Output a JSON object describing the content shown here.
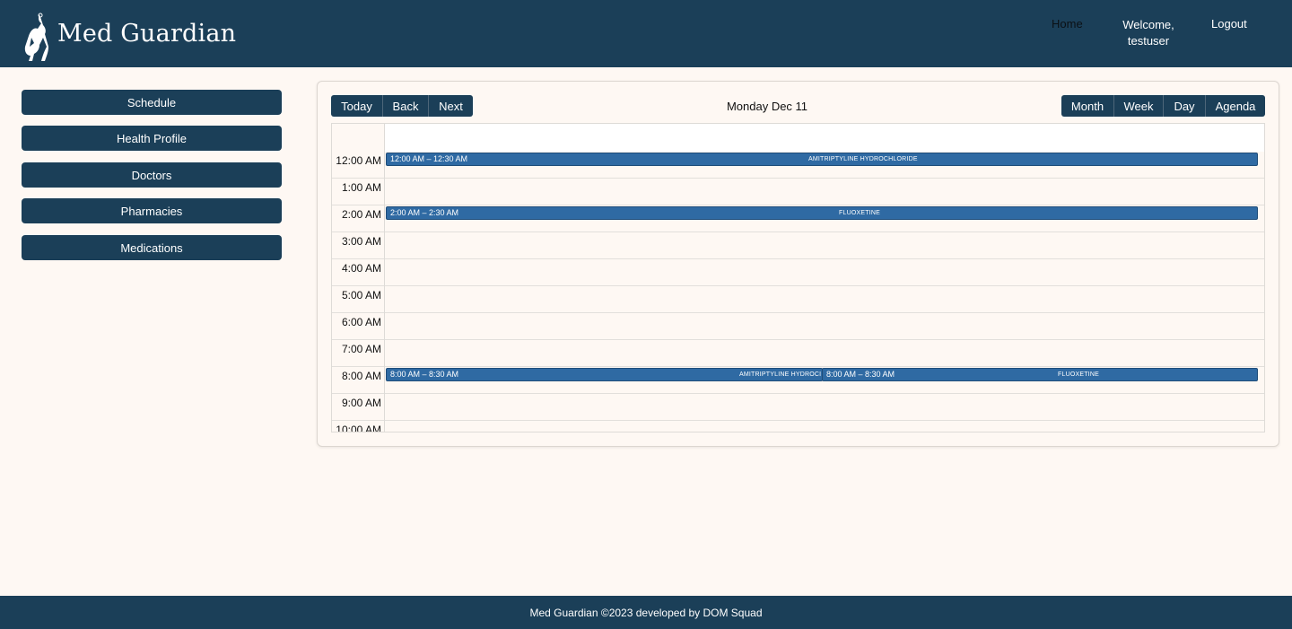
{
  "header": {
    "brand": "Med Guardian",
    "nav": {
      "home": "Home",
      "welcome": "Welcome,",
      "username": "testuser",
      "logout": "Logout"
    }
  },
  "sidebar": {
    "items": [
      {
        "label": "Schedule"
      },
      {
        "label": "Health Profile"
      },
      {
        "label": "Doctors"
      },
      {
        "label": "Pharmacies"
      },
      {
        "label": "Medications"
      }
    ]
  },
  "calendar": {
    "nav_buttons": {
      "today": "Today",
      "back": "Back",
      "next": "Next"
    },
    "title": "Monday Dec 11",
    "views": {
      "month": "Month",
      "week": "Week",
      "day": "Day",
      "agenda": "Agenda"
    },
    "hours": [
      "12:00 AM",
      "1:00 AM",
      "2:00 AM",
      "3:00 AM",
      "4:00 AM",
      "5:00 AM",
      "6:00 AM",
      "7:00 AM",
      "8:00 AM",
      "9:00 AM",
      "10:00 AM"
    ],
    "events": [
      {
        "time": "12:00 AM – 12:30 AM",
        "name": "AMITRIPTYLINE HYDROCHLORIDE"
      },
      {
        "time": "2:00 AM – 2:30 AM",
        "name": "FLUOXETINE"
      },
      {
        "time": "8:00 AM – 8:30 AM",
        "name": "AMITRIPTYLINE HYDROCI"
      },
      {
        "time": "8:00 AM – 8:30 AM",
        "name": "FLUOXETINE"
      }
    ]
  },
  "footer": {
    "text": "Med Guardian ©2023 developed by DOM Squad"
  },
  "colors": {
    "primary": "#1b3f58",
    "event": "#2f6aa3",
    "background": "#fef8f3"
  }
}
